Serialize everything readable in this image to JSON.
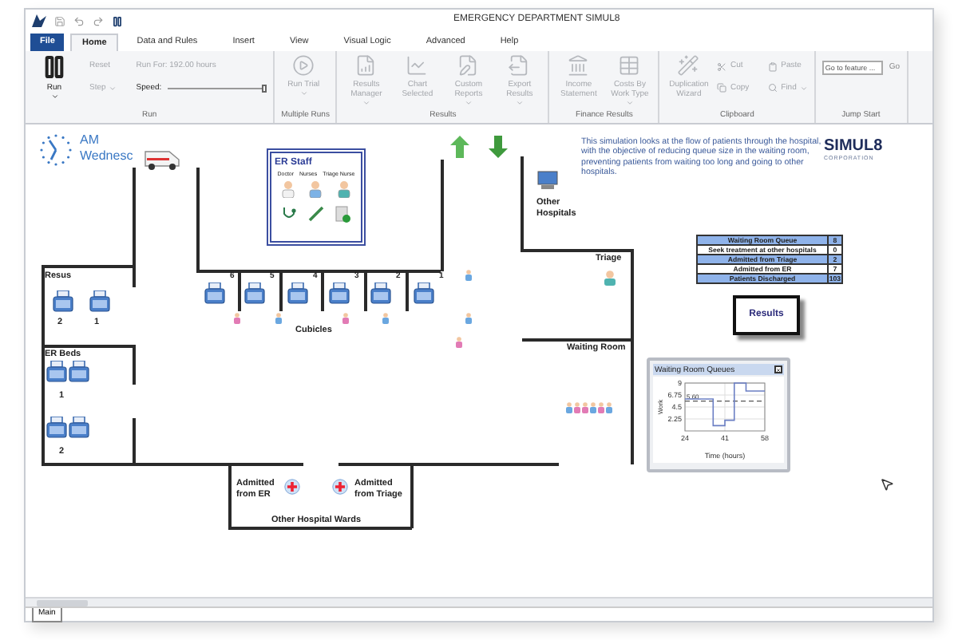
{
  "window": {
    "title": "EMERGENCY DEPARTMENT   SIMUL8"
  },
  "tabs": [
    {
      "label": "File",
      "kind": "file",
      "selected": false
    },
    {
      "label": "Home",
      "kind": "tab",
      "selected": true
    },
    {
      "label": "Data and Rules",
      "kind": "tab",
      "selected": false
    },
    {
      "label": "Insert",
      "kind": "tab",
      "selected": false
    },
    {
      "label": "View",
      "kind": "tab",
      "selected": false
    },
    {
      "label": "Visual Logic",
      "kind": "tab",
      "selected": false
    },
    {
      "label": "Advanced",
      "kind": "tab",
      "selected": false
    },
    {
      "label": "Help",
      "kind": "tab",
      "selected": false
    }
  ],
  "ribbon": [
    {
      "label": "Run",
      "items": [
        {
          "kind": "large",
          "label": "Run",
          "dropdown": true,
          "disabled": false
        },
        {
          "kind": "small",
          "label": "Reset",
          "dropdown": false,
          "disabled": true
        },
        {
          "kind": "small",
          "label": "Step",
          "dropdown": true,
          "disabled": true
        },
        {
          "kind": "text",
          "label": "Run For: 192.00 hours",
          "disabled": true
        },
        {
          "kind": "slider",
          "label": "Speed:",
          "level": 1
        }
      ]
    },
    {
      "label": "Multiple Runs",
      "items": [
        {
          "kind": "large",
          "label": "Run Trial",
          "dropdown": true,
          "disabled": true
        }
      ]
    },
    {
      "label": "Results",
      "items": [
        {
          "kind": "large",
          "label": "Results Manager",
          "dropdown": true,
          "disabled": true
        },
        {
          "kind": "large",
          "label": "Chart Selected",
          "dropdown": false,
          "disabled": true
        },
        {
          "kind": "large",
          "label": "Custom Reports",
          "dropdown": true,
          "disabled": true
        },
        {
          "kind": "large",
          "label": "Export Results",
          "dropdown": true,
          "disabled": true
        }
      ]
    },
    {
      "label": "Finance Results",
      "items": [
        {
          "kind": "large",
          "label": "Income Statement",
          "dropdown": false,
          "disabled": true
        },
        {
          "kind": "large",
          "label": "Costs By Work Type",
          "dropdown": true,
          "disabled": true
        }
      ]
    },
    {
      "label": "Clipboard",
      "items": [
        {
          "kind": "large",
          "label": "Duplication Wizard",
          "dropdown": false,
          "disabled": true
        },
        {
          "kind": "small",
          "label": "Cut",
          "dropdown": false,
          "disabled": true
        },
        {
          "kind": "small",
          "label": "Copy",
          "dropdown": false,
          "disabled": true
        },
        {
          "kind": "small",
          "label": "Paste",
          "dropdown": false,
          "disabled": true
        },
        {
          "kind": "small",
          "label": "Find",
          "dropdown": true,
          "disabled": true
        }
      ]
    },
    {
      "label": "Jump Start",
      "items": [
        {
          "kind": "field",
          "placeholder": "Go to feature ...",
          "action": "Go"
        }
      ]
    }
  ],
  "canvas": {
    "clock": {
      "period": "AM",
      "day": "Wednesc"
    },
    "description": "This simulation looks at the flow of patients through the hospital, with the objective of reducing queue size in the waiting room, preventing patients from waiting too long and going to other hospitals.",
    "logo": {
      "name": "SIMUL8",
      "subtitle": "CORPORATION"
    },
    "er_staff": {
      "title": "ER Staff",
      "roles": [
        "Doctor",
        "Nurses",
        "Triage Nurse"
      ]
    },
    "other_hospitals": "Other Hospitals",
    "areas": {
      "resus": "Resus",
      "er_beds": "ER Beds",
      "cubicles": "Cubicles",
      "triage": "Triage",
      "waiting_room": "Waiting Room",
      "wards": "Other Hospital Wards",
      "admitted_er": "Admitted from ER",
      "admitted_triage": "Admitted from Triage"
    },
    "resus_beds": [
      "2",
      "1"
    ],
    "er_bed_rows": [
      "1",
      "2"
    ],
    "cubicle_beds": [
      "6",
      "5",
      "4",
      "3",
      "2",
      "1"
    ],
    "stats": [
      {
        "label": "Waiting Room Queue",
        "value": "8"
      },
      {
        "label": "Seek treatment at other hospitals",
        "value": "0"
      },
      {
        "label": "Admitted from Triage",
        "value": "2"
      },
      {
        "label": "Admitted from ER",
        "value": "7"
      },
      {
        "label": "Patients Discharged",
        "value": "103"
      }
    ],
    "results_button": "Results",
    "chart_window": {
      "title": "Waiting Room Queues",
      "chart_data": {
        "type": "line",
        "xlabel": "Time (hours)",
        "ylabel": "Work",
        "x": [
          24,
          36,
          36,
          41,
          41,
          45,
          45,
          50,
          50,
          58
        ],
        "series": [
          {
            "color": "#6b7fc4",
            "values": [
              6,
              6,
              1,
              1,
              2,
              2,
              9,
              9,
              7.5,
              7.5
            ]
          }
        ],
        "xlim": [
          24,
          58
        ],
        "ylim": [
          0,
          9
        ],
        "grid": true,
        "xticks": [
          24,
          41,
          58
        ],
        "yticks": [
          2.25,
          4.5,
          6.75,
          9
        ],
        "ref_lines": [
          {
            "axis": "y",
            "value": 5.6,
            "label": "5.60"
          }
        ]
      }
    }
  },
  "sheet_tabs": [
    {
      "label": "Main",
      "selected": true
    }
  ]
}
